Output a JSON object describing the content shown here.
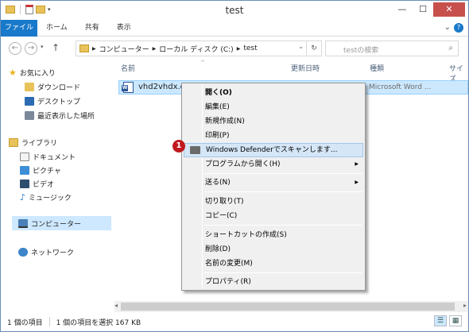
{
  "window": {
    "title": "test"
  },
  "ribbon": {
    "tabs": [
      "ファイル",
      "ホーム",
      "共有",
      "表示"
    ]
  },
  "address": {
    "segments": [
      "コンピューター",
      "ローカル ディスク (C:)",
      "test"
    ],
    "search_placeholder": "testの検索"
  },
  "nav": {
    "favorites": "お気に入り",
    "downloads": "ダウンロード",
    "desktop": "デスクトップ",
    "recent": "最近表示した場所",
    "libraries": "ライブラリ",
    "documents": "ドキュメント",
    "pictures": "ピクチャ",
    "videos": "ビデオ",
    "music": "ミュージック",
    "computer": "コンピューター",
    "network": "ネットワーク"
  },
  "columns": {
    "name": "名前",
    "date": "更新日時",
    "type": "種類",
    "size": "サイズ"
  },
  "file": {
    "name": "vhd2vhdx.do",
    "type": "Microsoft Word ..."
  },
  "context_menu": {
    "open": "開く(O)",
    "edit": "編集(E)",
    "new": "新規作成(N)",
    "print": "印刷(P)",
    "defender": "Windows Defenderでスキャンします...",
    "open_with": "プログラムから開く(H)",
    "send_to": "送る(N)",
    "cut": "切り取り(T)",
    "copy": "コピー(C)",
    "shortcut": "ショートカットの作成(S)",
    "delete": "削除(D)",
    "rename": "名前の変更(M)",
    "properties": "プロパティ(R)"
  },
  "callout": "1",
  "status": {
    "items": "1 個の項目",
    "selected": "1 個の項目を選択  167 KB"
  },
  "colors": {
    "accent": "#1979ca",
    "selection": "#cce8ff",
    "highlight": "#d5e6f7",
    "callout": "#c0191e"
  }
}
